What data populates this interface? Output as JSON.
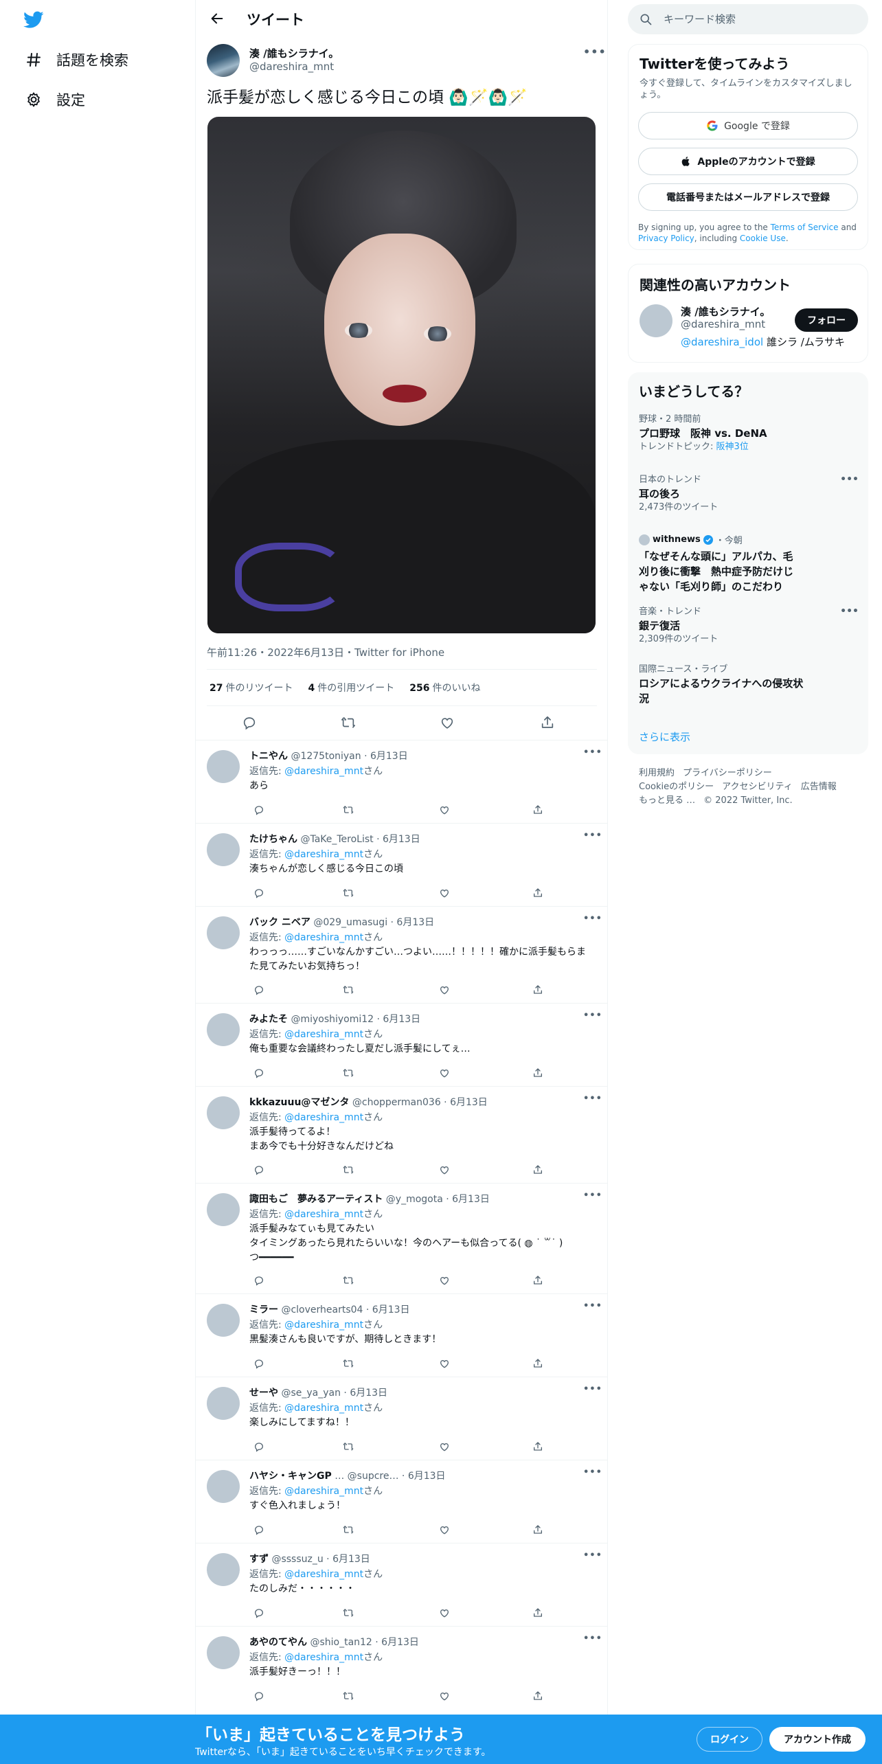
{
  "nav": {
    "explore_label": "話題を検索",
    "settings_label": "設定"
  },
  "header": {
    "title": "ツイート"
  },
  "tweet": {
    "author_name": "湊 /誰もシラナイ。",
    "author_handle": "@dareshira_mnt",
    "text": "派手髪が恋しく感じる今日この頃 🙆🏻‍♂️🪄🙆🏻‍♂️🪄",
    "meta": "午前11:26・2022年6月13日・Twitter for iPhone",
    "retweets_count": "27",
    "retweets_label": "件のリツイート",
    "quotes_count": "4",
    "quotes_label": "件の引用ツイート",
    "likes_count": "256",
    "likes_label": "件のいいね"
  },
  "reply_prefix": "返信先: ",
  "reply_suffix": "さん",
  "replies": [
    {
      "name": "トニやん",
      "handle": "@1275toniyan · 6月13日",
      "to": "@dareshira_mnt",
      "body": "あら"
    },
    {
      "name": "たけちゃん",
      "handle": "@TaKe_TeroList · 6月13日",
      "to": "@dareshira_mnt",
      "body": "湊ちゃんが恋しく感じる今日この頃"
    },
    {
      "name": "バック ニベア",
      "handle": "@029_umasugi · 6月13日",
      "to": "@dareshira_mnt",
      "body": "わっっっ……すごいなんかすごい…つよい……！！！！！確かに派手髪もらまた見てみたいお気持ちっ！"
    },
    {
      "name": "みよたそ",
      "handle": "@miyoshiyomi12 · 6月13日",
      "to": "@dareshira_mnt",
      "body": "俺も重要な会議終わったし夏だし派手髪にしてぇ…"
    },
    {
      "name": "kkkazuuu@マゼンタ",
      "handle": "@chopperman036 · 6月13日",
      "to": "@dareshira_mnt",
      "body": "派手髪待ってるよ！\nまあ今でも十分好きなんだけどね"
    },
    {
      "name": "諏田もご　夢みるアーティスト",
      "handle": "@y_mogota · 6月13日",
      "to": "@dareshira_mnt",
      "body": "派手髪みなてぃも見てみたい\nタイミングあったら見れたらいいな！今のヘアーも似合ってる( ◍ ˙ ꒳˙ )\nつ━━━━━━"
    },
    {
      "name": "ミラー",
      "handle": "@cloverhearts04 · 6月13日",
      "to": "@dareshira_mnt",
      "body": "黒髪湊さんも良いですが、期待しときます！"
    },
    {
      "name": "せーや",
      "handle": "@se_ya_yan · 6月13日",
      "to": "@dareshira_mnt",
      "body": "楽しみにしてますね！！"
    },
    {
      "name": "ハヤシ・キャンGP",
      "handle": "… @supcre… · 6月13日",
      "to": "@dareshira_mnt",
      "body": "すぐ色入れましょう！"
    },
    {
      "name": "すず",
      "handle": "@ssssuz_u · 6月13日",
      "to": "@dareshira_mnt",
      "body": "たのしみだ・・・・・・"
    },
    {
      "name": "あやのてやん",
      "handle": "@shio_tan12 · 6月13日",
      "to": "@dareshira_mnt",
      "body": "派手髪好きーっ！！！"
    }
  ],
  "search": {
    "placeholder": "キーワード検索"
  },
  "signup": {
    "title": "Twitterを使ってみよう",
    "subtitle": "今すぐ登録して、タイムラインをカスタマイズしましょう。",
    "google_label": "Google で登録",
    "apple_label": "Appleのアカウントで登録",
    "phone_label": "電話番号またはメールアドレスで登録",
    "terms_prefix": "By signing up, you agree to the ",
    "terms_link": "Terms of Service",
    "terms_and": " and ",
    "privacy_link": "Privacy Policy",
    "terms_including": ", including ",
    "cookie_link": "Cookie Use",
    "terms_end": "."
  },
  "related": {
    "title": "関連性の高いアカウント",
    "name": "湊 /誰もシラナイ。",
    "handle": "@dareshira_mnt",
    "bio_mention": "@dareshira_idol",
    "bio_text": " 誰シラ /ムラサキ",
    "follow_label": "フォロー"
  },
  "trends": {
    "title": "いまどうしてる？",
    "items": [
      {
        "category": "野球・2 時間前",
        "name": "プロ野球　阪神 vs. DeNA",
        "sub_prefix": "トレンドトピック: ",
        "sub_link": "阪神3位"
      },
      {
        "category": "日本のトレンド",
        "name": "耳の後ろ",
        "sub": "2,473件のツイート"
      },
      {
        "source": "withnews",
        "time": "・今朝",
        "name": "「なぜそんな頭に」アルパカ、毛刈り後に衝撃　熱中症予防だけじゃない「毛刈り師」のこだわり"
      },
      {
        "category": "音楽・トレンド",
        "name": "銀テ復活",
        "sub": "2,309件のツイート"
      },
      {
        "category": "国際ニュース・ライブ",
        "name": "ロシアによるウクライナへの侵攻状況"
      }
    ],
    "show_more": "さらに表示"
  },
  "footer": {
    "links": [
      "利用規約",
      "プライバシーポリシー",
      "Cookieのポリシー",
      "アクセシビリティ",
      "広告情報",
      "もっと見る …",
      "© 2022 Twitter, Inc."
    ]
  },
  "bottom_bar": {
    "title": "「いま」起きていることを見つけよう",
    "subtitle": "Twitterなら、「いま」起きていることをいち早くチェックできます。",
    "login_label": "ログイン",
    "signup_label": "アカウント作成"
  },
  "colors": {
    "accent": "#1d9bf0",
    "text": "#0f1419",
    "muted": "#536471"
  }
}
